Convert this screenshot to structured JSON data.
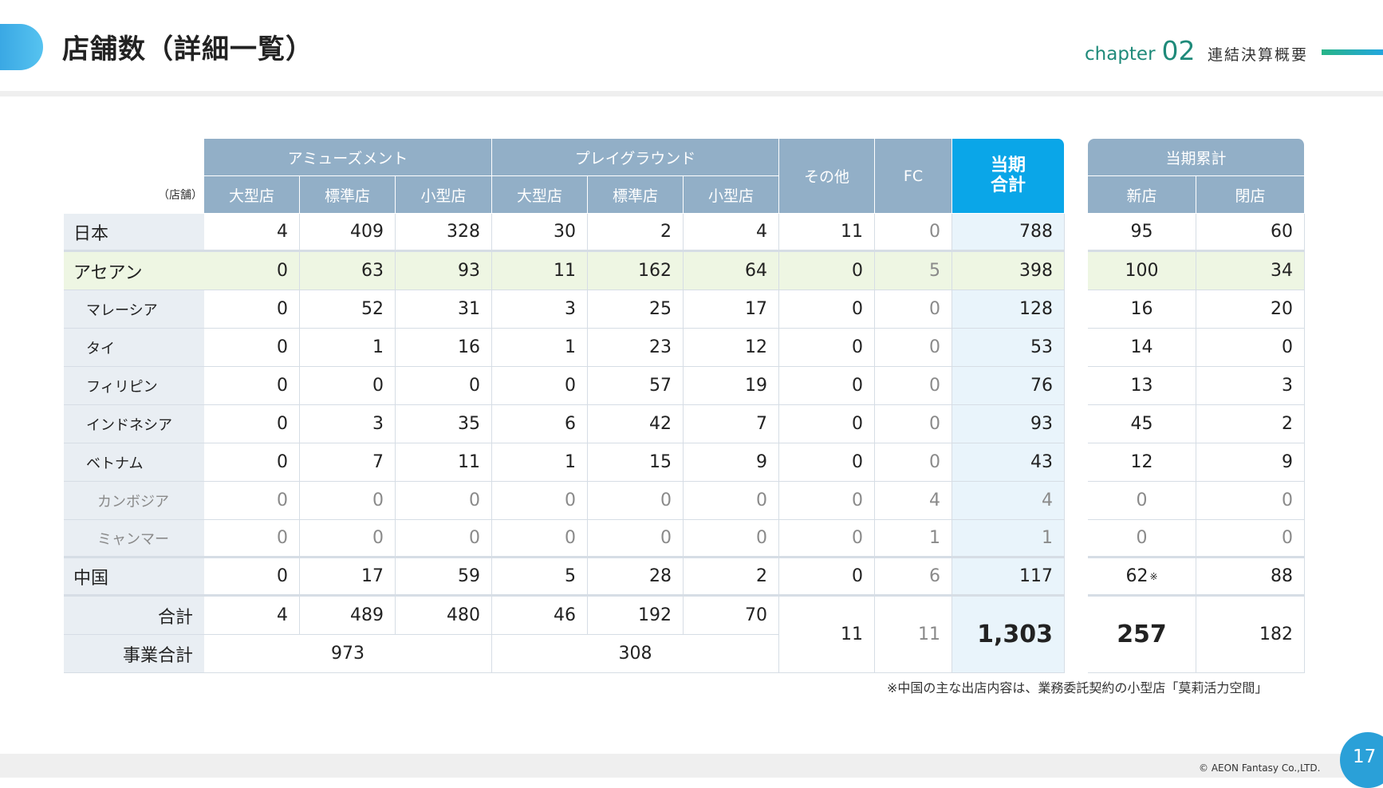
{
  "header": {
    "title": "店舗数（詳細一覧）",
    "chapter_word": "chapter",
    "chapter_number": "02",
    "chapter_label": "連結決算概要"
  },
  "table": {
    "unit": "（店舗）",
    "group_headers": {
      "amusement": "アミューズメント",
      "playground": "プレイグラウンド",
      "other": "その他",
      "fc": "FC",
      "total": "当期\n合計"
    },
    "sub_headers": [
      "大型店",
      "標準店",
      "小型店",
      "大型店",
      "標準店",
      "小型店"
    ],
    "rows": [
      {
        "label": "日本",
        "values": [
          "4",
          "409",
          "328",
          "30",
          "2",
          "4",
          "11",
          "0",
          "788"
        ]
      },
      {
        "label": "アセアン",
        "values": [
          "0",
          "63",
          "93",
          "11",
          "162",
          "64",
          "0",
          "5",
          "398"
        ]
      },
      {
        "label": "マレーシア",
        "values": [
          "0",
          "52",
          "31",
          "3",
          "25",
          "17",
          "0",
          "0",
          "128"
        ]
      },
      {
        "label": "タイ",
        "values": [
          "0",
          "1",
          "16",
          "1",
          "23",
          "12",
          "0",
          "0",
          "53"
        ]
      },
      {
        "label": "フィリピン",
        "values": [
          "0",
          "0",
          "0",
          "0",
          "57",
          "19",
          "0",
          "0",
          "76"
        ]
      },
      {
        "label": "インドネシア",
        "values": [
          "0",
          "3",
          "35",
          "6",
          "42",
          "7",
          "0",
          "0",
          "93"
        ]
      },
      {
        "label": "ベトナム",
        "values": [
          "0",
          "7",
          "11",
          "1",
          "15",
          "9",
          "0",
          "0",
          "43"
        ]
      },
      {
        "label": "カンボジア",
        "values": [
          "0",
          "0",
          "0",
          "0",
          "0",
          "0",
          "0",
          "4",
          "4"
        ]
      },
      {
        "label": "ミャンマー",
        "values": [
          "0",
          "0",
          "0",
          "0",
          "0",
          "0",
          "0",
          "1",
          "1"
        ]
      },
      {
        "label": "中国",
        "values": [
          "0",
          "17",
          "59",
          "5",
          "28",
          "2",
          "0",
          "6",
          "117"
        ]
      }
    ],
    "total_row": {
      "label": "合計",
      "values": [
        "4",
        "489",
        "480",
        "46",
        "192",
        "70"
      ]
    },
    "business_total_row": {
      "label": "事業合計",
      "amusement": "973",
      "playground": "308"
    },
    "other_total": "11",
    "fc_total": "11",
    "grand_total": "1,303"
  },
  "cumulative": {
    "title": "当期累計",
    "col_new": "新店",
    "col_closed": "閉店",
    "rows": [
      {
        "new": "95",
        "closed": "60"
      },
      {
        "new": "100",
        "closed": "34"
      },
      {
        "new": "16",
        "closed": "20"
      },
      {
        "new": "14",
        "closed": "0"
      },
      {
        "new": "13",
        "closed": "3"
      },
      {
        "new": "45",
        "closed": "2"
      },
      {
        "new": "12",
        "closed": "9"
      },
      {
        "new": "0",
        "closed": "0"
      },
      {
        "new": "0",
        "closed": "0"
      },
      {
        "new": "62",
        "closed": "88"
      }
    ],
    "china_note_mark": "※",
    "total_new": "257",
    "total_closed": "182"
  },
  "footnote": "※中国の主な出店内容は、業務委託契約の小型店「莫莉活力空間」",
  "footer": {
    "copyright": "© AEON Fantasy Co.,LTD.",
    "page_number": "17"
  }
}
